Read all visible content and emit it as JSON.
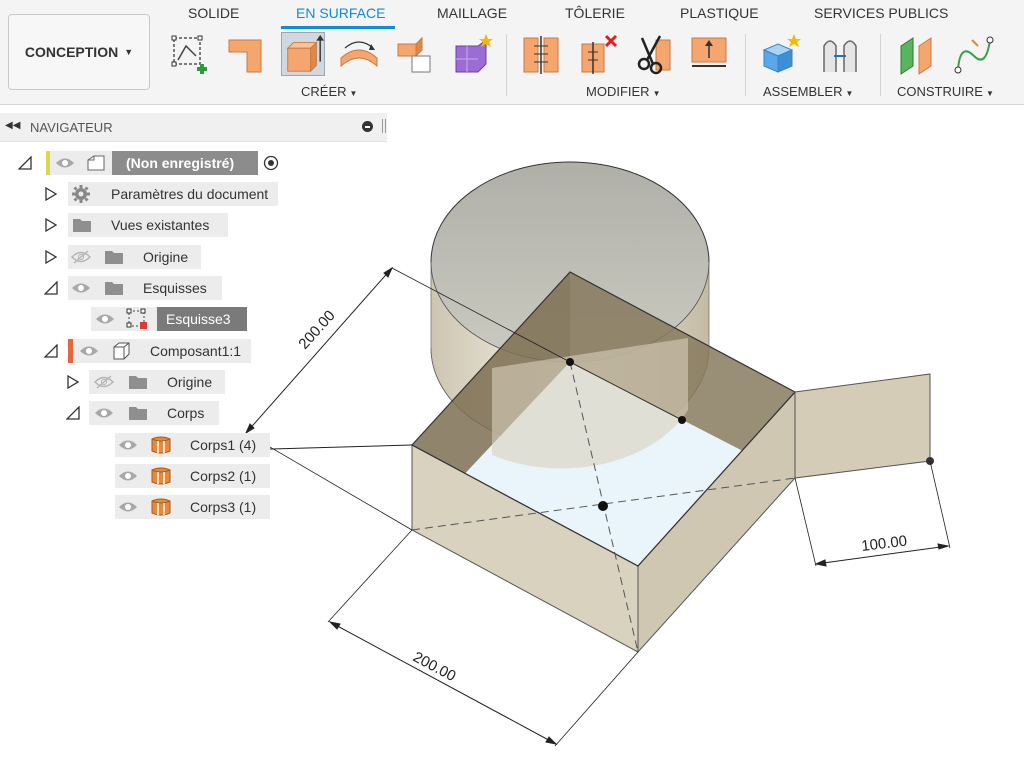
{
  "workspace": {
    "label": "CONCEPTION"
  },
  "tabs": [
    {
      "label": "SOLIDE"
    },
    {
      "label": "EN SURFACE"
    },
    {
      "label": "MAILLAGE"
    },
    {
      "label": "TÔLERIE"
    },
    {
      "label": "PLASTIQUE"
    },
    {
      "label": "SERVICES PUBLICS"
    }
  ],
  "active_tab": "EN SURFACE",
  "groups": {
    "creer": "CRÉER",
    "modifier": "MODIFIER",
    "assembler": "ASSEMBLER",
    "construire": "CONSTRUIRE"
  },
  "navigator": {
    "title": "NAVIGATEUR",
    "root": "(Non enregistré)",
    "items": [
      {
        "label": "Paramètres du document"
      },
      {
        "label": "Vues existantes"
      },
      {
        "label": "Origine"
      },
      {
        "label": "Esquisses"
      },
      {
        "label": "Esquisse3"
      },
      {
        "label": "Composant1:1"
      },
      {
        "label": "Origine"
      },
      {
        "label": "Corps"
      },
      {
        "label": "Corps1 (4)"
      },
      {
        "label": "Corps2 (1)"
      },
      {
        "label": "Corps3 (1)"
      }
    ]
  },
  "dimensions": {
    "left": "200.00",
    "bottom": "200.00",
    "right": "100.00"
  },
  "colors": {
    "accent": "#0d8ddb",
    "tool_orange": "#f5a66e",
    "body_orange": "#e8893a",
    "surface": "#dcd6c4",
    "hole": "#eaf4fb"
  }
}
